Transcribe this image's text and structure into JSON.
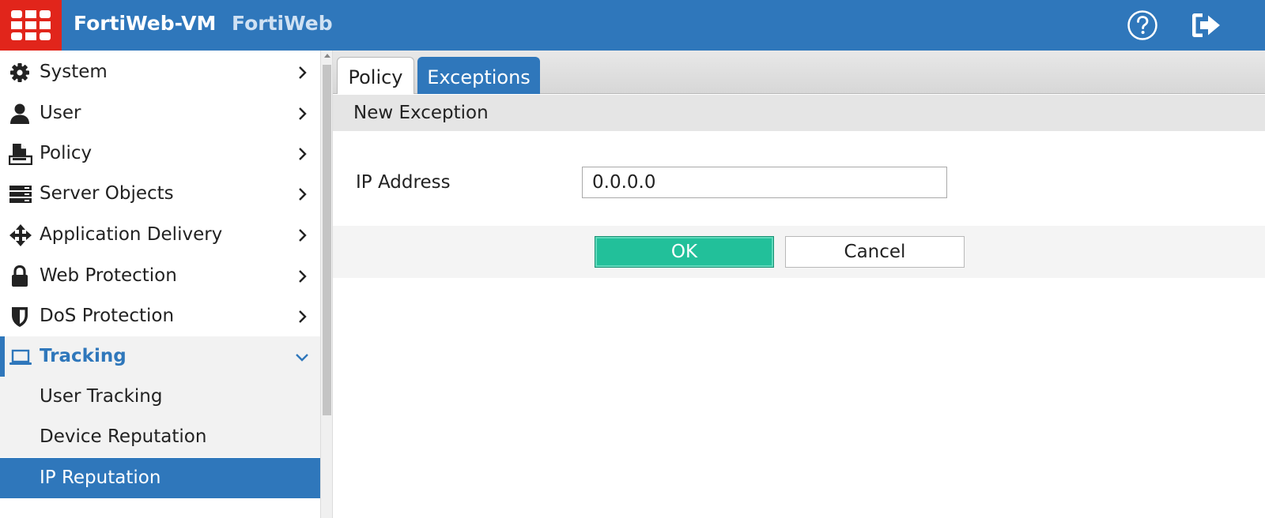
{
  "header": {
    "device_name": "FortiWeb-VM",
    "product_name": "FortiWeb",
    "help_icon": "help-circle-icon",
    "logout_icon": "logout-icon"
  },
  "sidebar": {
    "items": [
      {
        "label": "System",
        "icon": "gear-icon"
      },
      {
        "label": "User",
        "icon": "user-icon"
      },
      {
        "label": "Policy",
        "icon": "policy-icon"
      },
      {
        "label": "Server Objects",
        "icon": "server-icon"
      },
      {
        "label": "Application Delivery",
        "icon": "move-arrows-icon"
      },
      {
        "label": "Web Protection",
        "icon": "lock-icon"
      },
      {
        "label": "DoS Protection",
        "icon": "shield-icon"
      },
      {
        "label": "Tracking",
        "icon": "laptop-icon",
        "expanded": true
      }
    ],
    "subitems": [
      {
        "label": "User Tracking"
      },
      {
        "label": "Device Reputation"
      },
      {
        "label": "IP Reputation",
        "selected": true
      }
    ]
  },
  "tabs": [
    {
      "label": "Policy"
    },
    {
      "label": "Exceptions",
      "active": true
    }
  ],
  "form": {
    "section_title": "New Exception",
    "ip_label": "IP Address",
    "ip_value": "0.0.0.0",
    "ok_label": "OK",
    "cancel_label": "Cancel"
  },
  "colors": {
    "header_blue": "#2f77bb",
    "logo_red": "#e1251b",
    "ok_green": "#22c09a"
  }
}
